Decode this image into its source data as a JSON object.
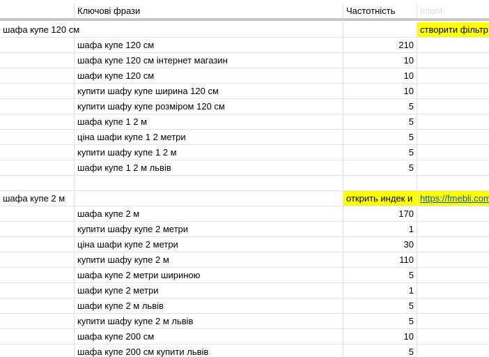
{
  "header": {
    "col_b": "Ключові фрази",
    "col_c": "Частотність",
    "col_d": "Intent"
  },
  "groups": [
    {
      "name": "шафа купе 120 см",
      "note": "створити фільтр",
      "rows": [
        {
          "phrase": "шафа купе 120 см",
          "freq": "210"
        },
        {
          "phrase": "шафа купе 120 см інтернет магазин",
          "freq": "10"
        },
        {
          "phrase": "шафи купе 120 см",
          "freq": "10"
        },
        {
          "phrase": "купити шафу купе ширина 120 см",
          "freq": "10"
        },
        {
          "phrase": "купити шафу купе розміром 120 см",
          "freq": "5"
        },
        {
          "phrase": "шафа купе 1 2 м",
          "freq": "5"
        },
        {
          "phrase": "ціна шафи купе 1 2 метри",
          "freq": "5"
        },
        {
          "phrase": "купити шафу купе 1 2 м",
          "freq": "5"
        },
        {
          "phrase": "шафи купе 1 2 м львів",
          "freq": "5"
        }
      ]
    },
    {
      "name": "шафа купе 2 м",
      "note": "открить индек и",
      "link": "https://fmebli.com",
      "rows": [
        {
          "phrase": "шафа купе 2 м",
          "freq": "170"
        },
        {
          "phrase": "купити шафу купе 2 метри",
          "freq": "1"
        },
        {
          "phrase": "ціна шафи купе 2 метри",
          "freq": "30"
        },
        {
          "phrase": "купити шафу купе 2 м",
          "freq": "110"
        },
        {
          "phrase": "шафа купе 2 метри шириною",
          "freq": "5"
        },
        {
          "phrase": "шафи купе 2 метри",
          "freq": "1"
        },
        {
          "phrase": "шафи купе 2 м львів",
          "freq": "5"
        },
        {
          "phrase": "купити шафу купе 2 м львів",
          "freq": "5"
        },
        {
          "phrase": "шафа купе 200 см",
          "freq": "10"
        },
        {
          "phrase": "шафа купе 200 см купити львів",
          "freq": "5"
        }
      ]
    }
  ]
}
